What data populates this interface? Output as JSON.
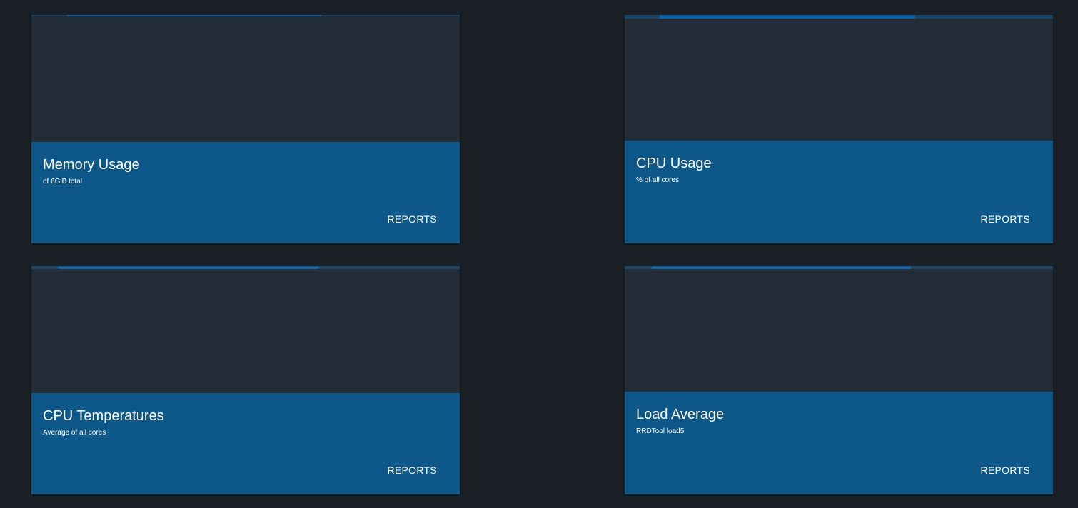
{
  "colors": {
    "page_background": "#1a1f26",
    "card_background": "#232d37",
    "card_footer": "#0e5789",
    "loader_track": "#1c4669",
    "loader_bar": "#0e63a6"
  },
  "cards": [
    {
      "title": "Memory Usage",
      "subtitle": "of 6GiB total",
      "action": "REPORTS"
    },
    {
      "title": "CPU Usage",
      "subtitle": "% of all cores",
      "action": "REPORTS"
    },
    {
      "title": "CPU Temperatures",
      "subtitle": "Average of all cores",
      "action": "REPORTS"
    },
    {
      "title": "Load Average",
      "subtitle": "RRDTool load5",
      "action": "REPORTS"
    }
  ]
}
